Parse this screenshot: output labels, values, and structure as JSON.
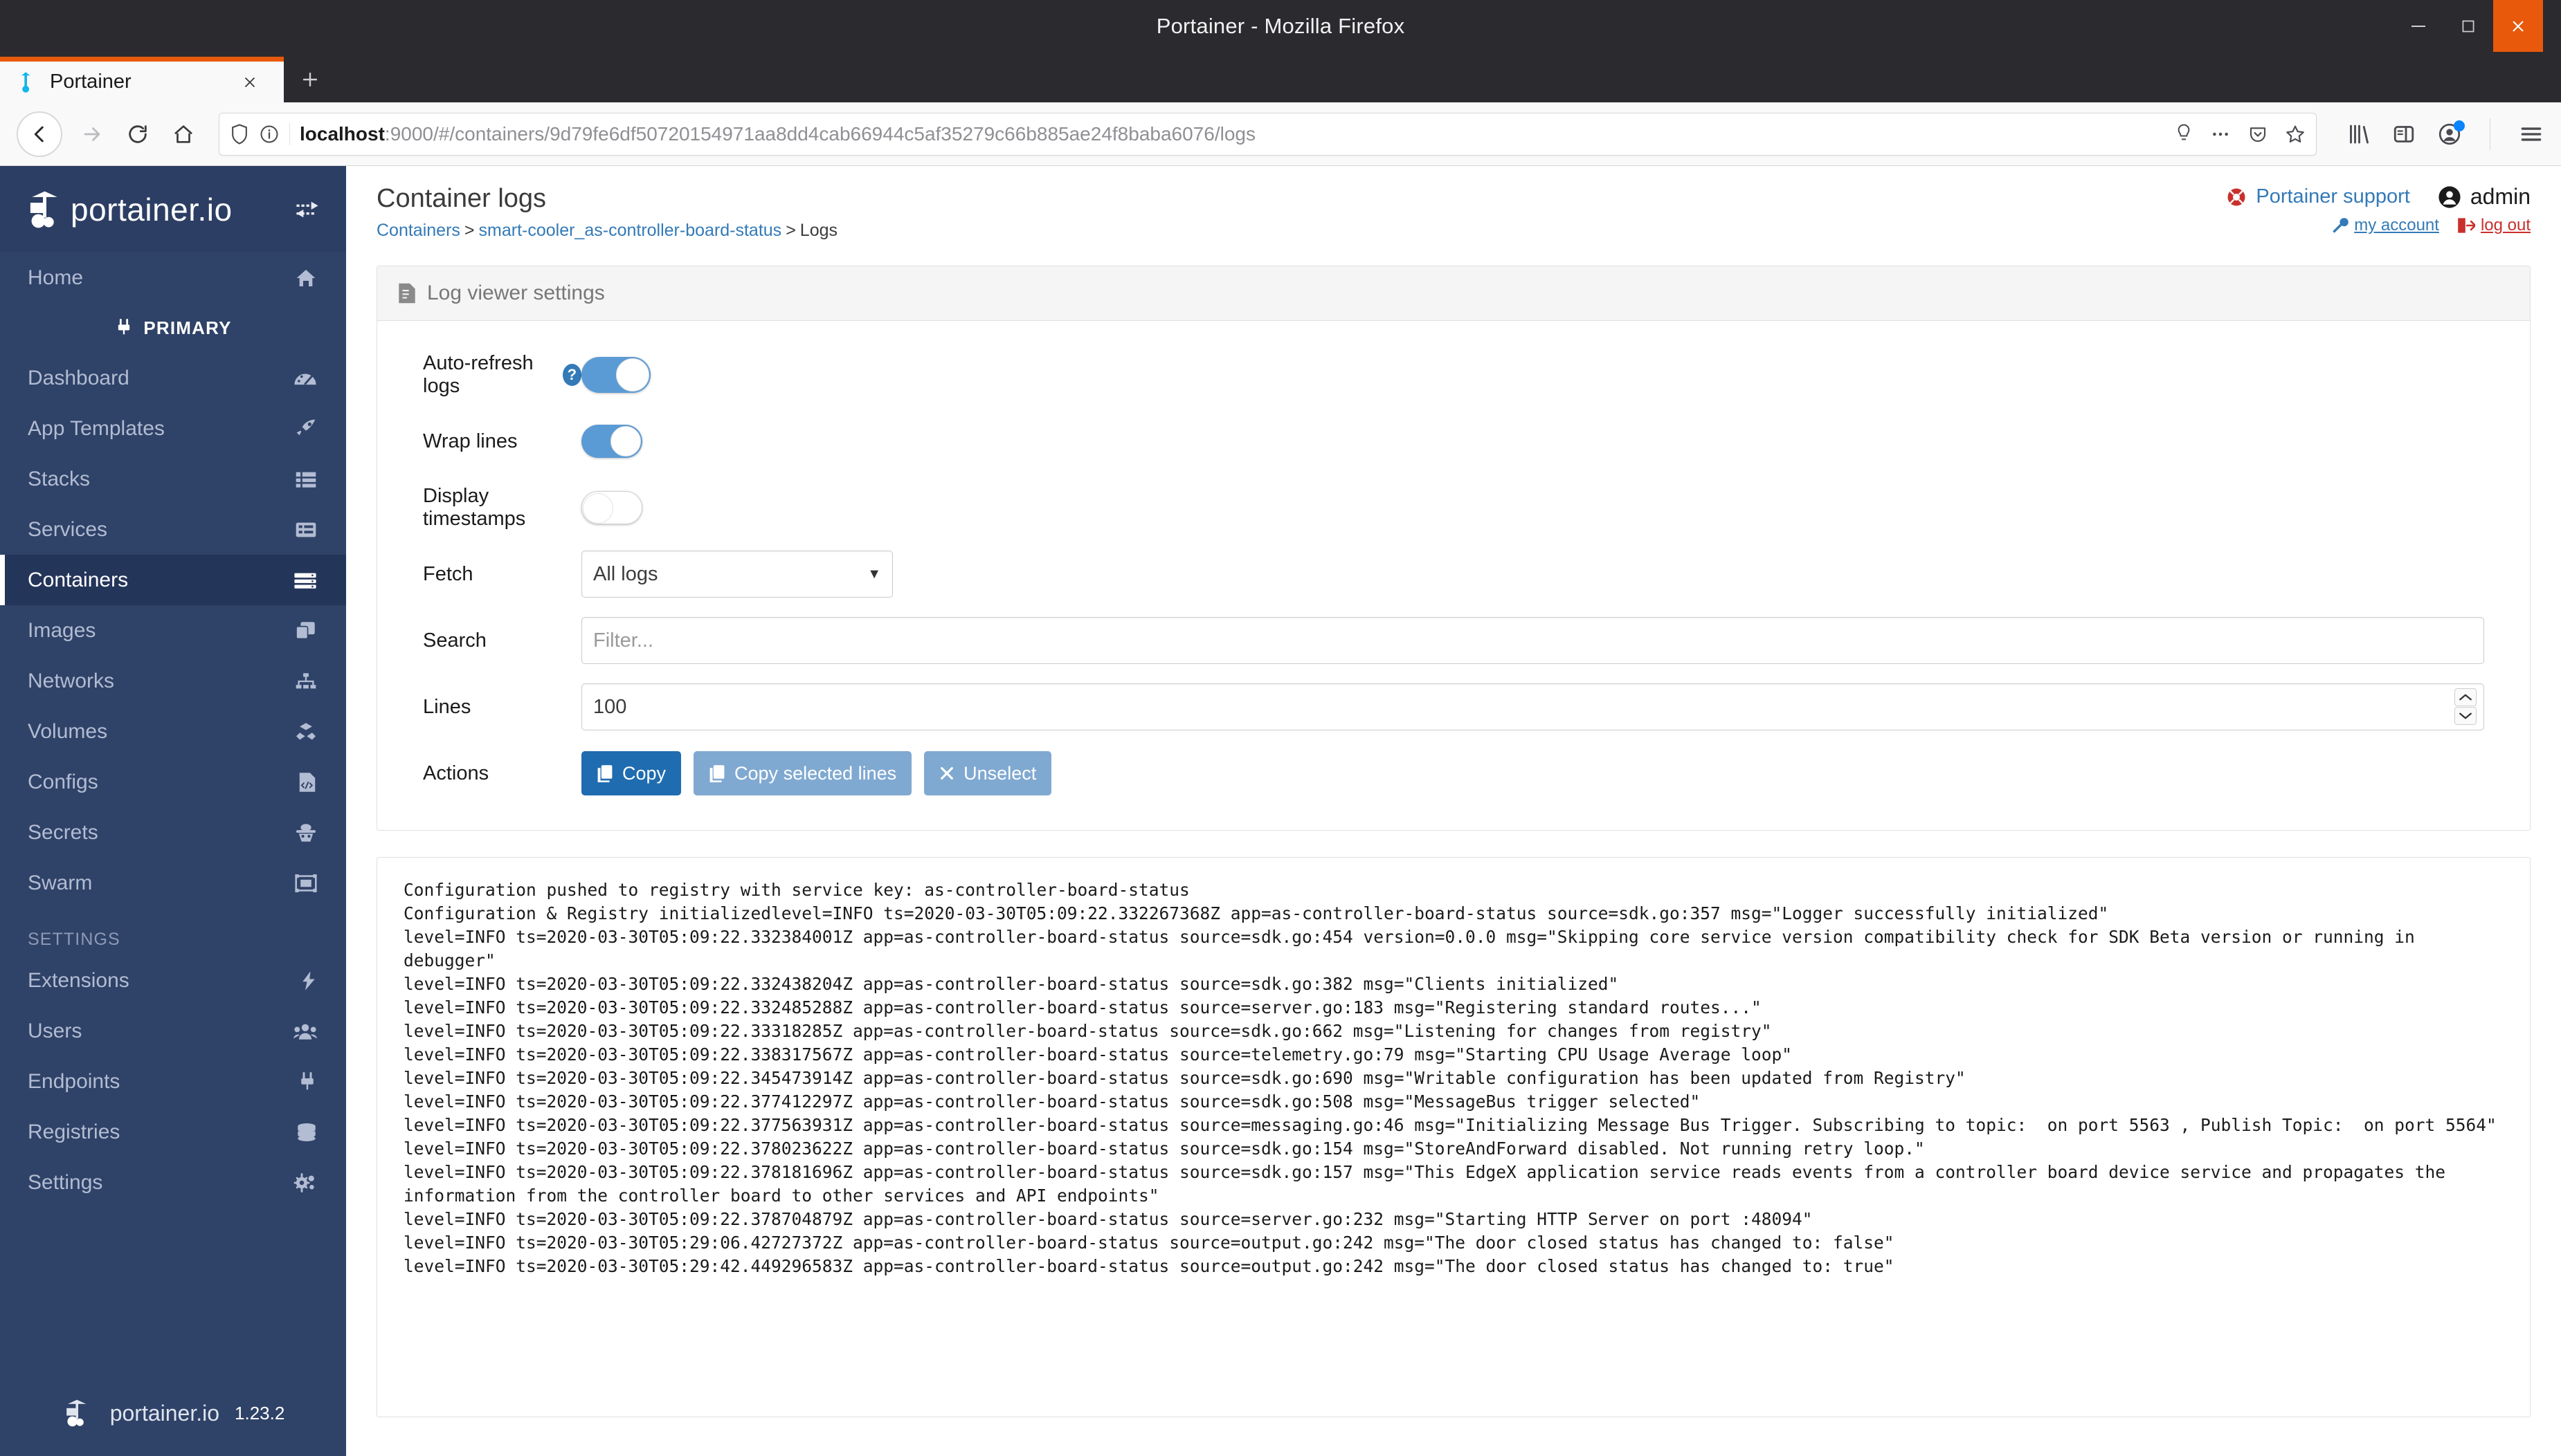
{
  "browser": {
    "window_title": "Portainer - Mozilla Firefox",
    "minimize_label": "−",
    "maximize_label": "❐",
    "close_label": "×",
    "tab_title": "Portainer",
    "tab_close_label": "×",
    "new_tab_label": "+",
    "url_host": "localhost",
    "url_path": ":9000/#/containers/9d79fe6df50720154971aa8dd4cab66944c5af35279c66b885ae24f8baba6076/logs",
    "back_label": "←",
    "forward_label": "→",
    "reload_label": "↻",
    "home_label": "⌂"
  },
  "sidebar": {
    "logo_text": "portainer.io",
    "primary_label": "PRIMARY",
    "settings_label": "SETTINGS",
    "footer_text": "portainer.io",
    "version": "1.23.2",
    "items": [
      {
        "label": "Home",
        "icon": "home-icon",
        "glyph": "⌂"
      },
      {
        "label": "Dashboard",
        "icon": "dashboard-icon",
        "glyph": "◔"
      },
      {
        "label": "App Templates",
        "icon": "rocket-icon",
        "glyph": "➚"
      },
      {
        "label": "Stacks",
        "icon": "list-icon",
        "glyph": "☰"
      },
      {
        "label": "Services",
        "icon": "services-icon",
        "glyph": "≡"
      },
      {
        "label": "Containers",
        "icon": "containers-icon",
        "glyph": "⌸"
      },
      {
        "label": "Images",
        "icon": "images-icon",
        "glyph": "❐"
      },
      {
        "label": "Networks",
        "icon": "networks-icon",
        "glyph": "⛓"
      },
      {
        "label": "Volumes",
        "icon": "volumes-icon",
        "glyph": "❖"
      },
      {
        "label": "Configs",
        "icon": "configs-icon",
        "glyph": "⌨"
      },
      {
        "label": "Secrets",
        "icon": "secrets-icon",
        "glyph": "☢"
      },
      {
        "label": "Swarm",
        "icon": "swarm-icon",
        "glyph": "▣"
      },
      {
        "label": "Extensions",
        "icon": "bolt-icon",
        "glyph": "⚡"
      },
      {
        "label": "Users",
        "icon": "users-icon",
        "glyph": "⚇"
      },
      {
        "label": "Endpoints",
        "icon": "plug-icon",
        "glyph": "⚡"
      },
      {
        "label": "Registries",
        "icon": "database-icon",
        "glyph": "⛃"
      },
      {
        "label": "Settings",
        "icon": "gears-icon",
        "glyph": "⚙"
      }
    ],
    "active_item": "Containers"
  },
  "header": {
    "title": "Container logs",
    "breadcrumb": {
      "containers": "Containers",
      "container_name": "smart-cooler_as-controller-board-status",
      "current": "Logs",
      "separator": ">"
    },
    "support_link": "Portainer support",
    "user_name": "admin",
    "my_account": "my account",
    "log_out": "log out"
  },
  "log_viewer_settings": {
    "panel_title": "Log viewer settings",
    "auto_refresh": {
      "label": "Auto-refresh logs",
      "state": "on",
      "has_help": true,
      "help_glyph": "?"
    },
    "wrap_lines": {
      "label": "Wrap lines",
      "state": "on"
    },
    "display_timestamps": {
      "label": "Display timestamps",
      "state": "off"
    },
    "fetch": {
      "label": "Fetch",
      "value": "All logs",
      "caret": "▼"
    },
    "search": {
      "label": "Search",
      "value": "",
      "placeholder": "Filter..."
    },
    "lines": {
      "label": "Lines",
      "value": "100",
      "spin_up": "⌃",
      "spin_down": "⌄"
    },
    "actions": {
      "label": "Actions",
      "buttons": [
        {
          "label": "Copy",
          "style": "primary",
          "icon": "copy-icon",
          "glyph": "⎘"
        },
        {
          "label": "Copy selected lines",
          "style": "muted",
          "icon": "copy-icon",
          "glyph": "⎘"
        },
        {
          "label": "Unselect",
          "style": "muted",
          "icon": "close-icon",
          "glyph": "✕"
        }
      ]
    }
  },
  "logs": {
    "lines": [
      "Configuration pushed to registry with service key: as-controller-board-status",
      "Configuration & Registry initializedlevel=INFO ts=2020-03-30T05:09:22.332267368Z app=as-controller-board-status source=sdk.go:357 msg=\"Logger successfully initialized\"",
      "level=INFO ts=2020-03-30T05:09:22.332384001Z app=as-controller-board-status source=sdk.go:454 version=0.0.0 msg=\"Skipping core service version compatibility check for SDK Beta version or running in debugger\"",
      "level=INFO ts=2020-03-30T05:09:22.332438204Z app=as-controller-board-status source=sdk.go:382 msg=\"Clients initialized\"",
      "level=INFO ts=2020-03-30T05:09:22.332485288Z app=as-controller-board-status source=server.go:183 msg=\"Registering standard routes...\"",
      "level=INFO ts=2020-03-30T05:09:22.33318285Z app=as-controller-board-status source=sdk.go:662 msg=\"Listening for changes from registry\"",
      "level=INFO ts=2020-03-30T05:09:22.338317567Z app=as-controller-board-status source=telemetry.go:79 msg=\"Starting CPU Usage Average loop\"",
      "level=INFO ts=2020-03-30T05:09:22.345473914Z app=as-controller-board-status source=sdk.go:690 msg=\"Writable configuration has been updated from Registry\"",
      "level=INFO ts=2020-03-30T05:09:22.377412297Z app=as-controller-board-status source=sdk.go:508 msg=\"MessageBus trigger selected\"",
      "level=INFO ts=2020-03-30T05:09:22.377563931Z app=as-controller-board-status source=messaging.go:46 msg=\"Initializing Message Bus Trigger. Subscribing to topic:  on port 5563 , Publish Topic:  on port 5564\"",
      "level=INFO ts=2020-03-30T05:09:22.378023622Z app=as-controller-board-status source=sdk.go:154 msg=\"StoreAndForward disabled. Not running retry loop.\"",
      "level=INFO ts=2020-03-30T05:09:22.378181696Z app=as-controller-board-status source=sdk.go:157 msg=\"This EdgeX application service reads events from a controller board device service and propagates the information from the controller board to other services and API endpoints\"",
      "level=INFO ts=2020-03-30T05:09:22.378704879Z app=as-controller-board-status source=server.go:232 msg=\"Starting HTTP Server on port :48094\"",
      "level=INFO ts=2020-03-30T05:29:06.42727372Z app=as-controller-board-status source=output.go:242 msg=\"The door closed status has changed to: false\"",
      "level=INFO ts=2020-03-30T05:29:42.449296583Z app=as-controller-board-status source=output.go:242 msg=\"The door closed status has changed to: true\""
    ]
  },
  "colors": {
    "sidebar_bg": "#2f4268",
    "sidebar_active": "#24355a",
    "link_blue": "#337ab7",
    "primary_button": "#1f6cb0",
    "muted_button": "#80a9d1",
    "toggle_on": "#5b9bd5",
    "firefox_orange": "#e8590c",
    "danger_red": "#c9302c"
  }
}
